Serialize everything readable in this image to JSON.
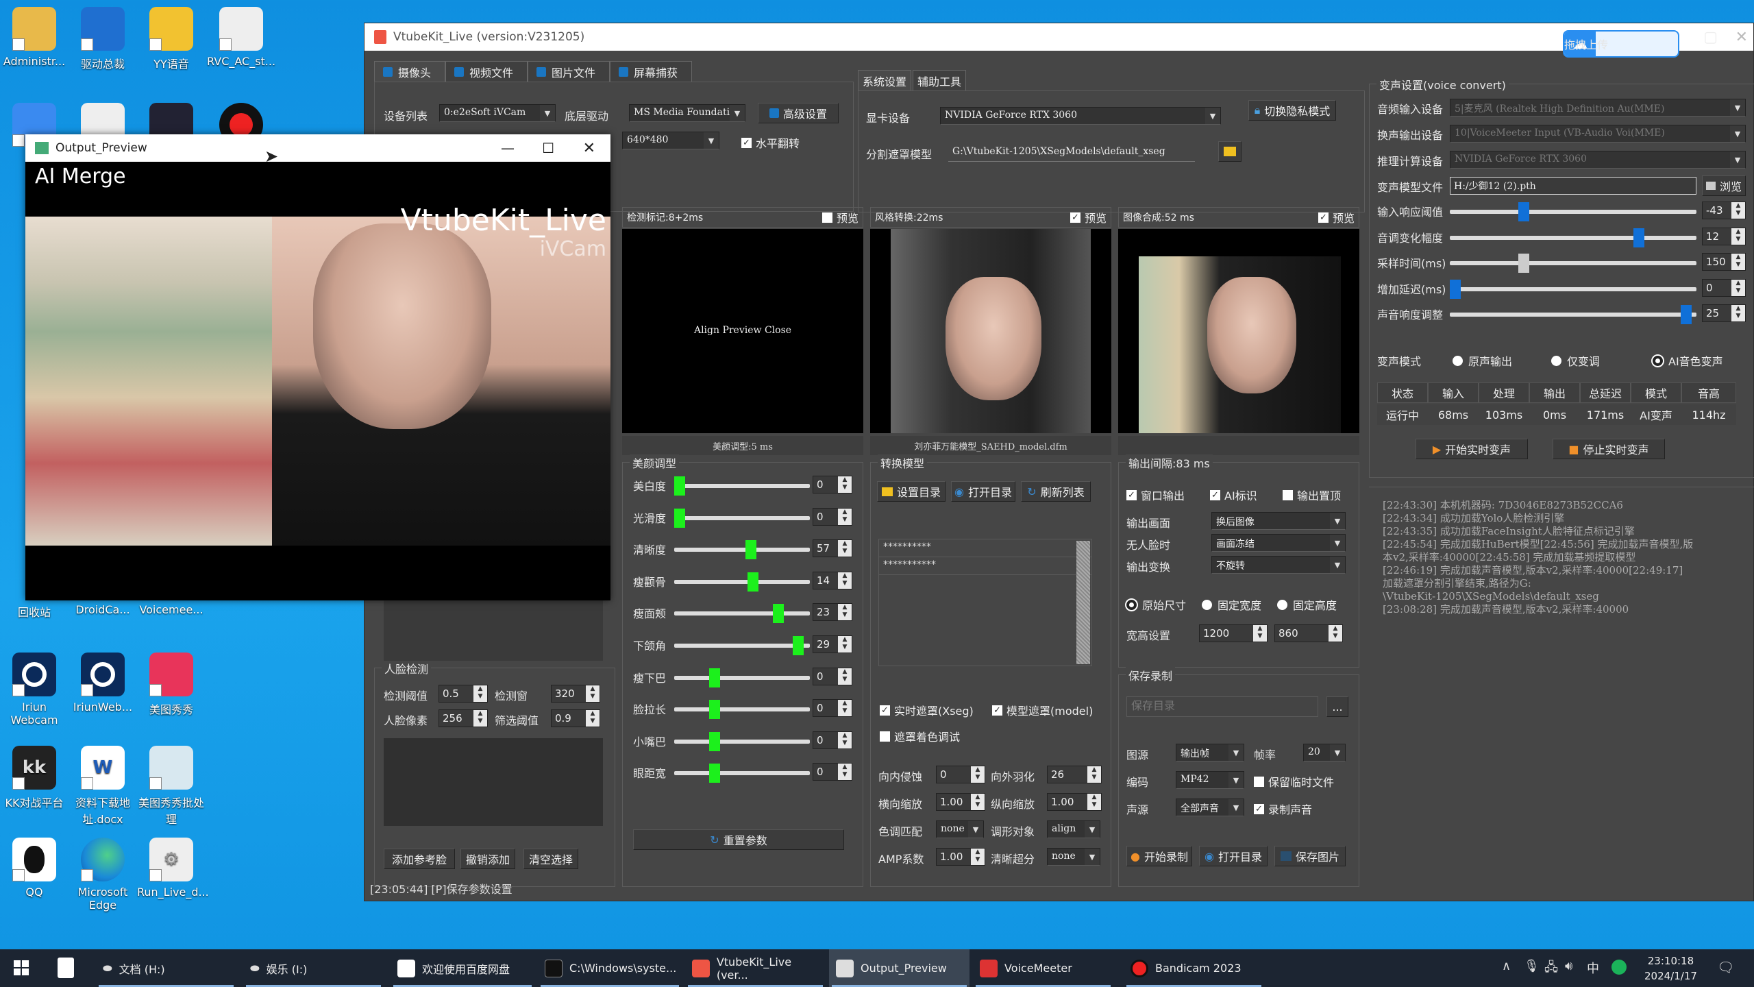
{
  "desktop": {
    "icons": [
      {
        "label": "Administr...",
        "color": "#e8b94a"
      },
      {
        "label": "驱动总裁",
        "color": "#1f6fd0"
      },
      {
        "label": "YY语音",
        "color": "#f2c230"
      },
      {
        "label": "RVC_AC_st...",
        "color": "#eeeeee"
      },
      {
        "label": "回收站",
        "color": "#9cc"
      },
      {
        "label": "DroidCa...",
        "color": "#4a4a4a"
      },
      {
        "label": "Voicemee...",
        "color": "#333"
      },
      {
        "label": "Iriun Webcam",
        "color": "#0b2a5a"
      },
      {
        "label": "IriunWeb...",
        "color": "#0b2a5a"
      },
      {
        "label": "美图秀秀",
        "color": "#e8345a"
      },
      {
        "label": "KK对战平台",
        "color": "#222"
      },
      {
        "label": "资料下载地址.docx",
        "color": "#fff"
      },
      {
        "label": "美图秀秀批处理",
        "color": "#d8e8f0"
      },
      {
        "label": "QQ",
        "color": "#fff"
      },
      {
        "label": "Microsoft Edge",
        "color": "#1a8ad8"
      },
      {
        "label": "Run_Live_d...",
        "color": "#eee"
      }
    ]
  },
  "main_window": {
    "title": "VtubeKit_Live (version:V231205)",
    "upload_button": "拖拽上传",
    "source_tabs": [
      "摄像头",
      "视频文件",
      "图片文件",
      "屏幕捕获"
    ],
    "camera": {
      "device_label": "设备列表",
      "device_value": "0:e2eSoft iVCam",
      "driver_label": "底层驱动",
      "driver_value": "MS Media Foundatio",
      "advanced_button": "高级设置",
      "resolution_value": "640*480",
      "hflip_label": "水平翻转",
      "hflip_checked": true
    },
    "system_tabs": [
      "系统设置",
      "辅助工具"
    ],
    "system": {
      "gpu_label": "显卡设备",
      "gpu_value": "NVIDIA GeForce RTX 3060",
      "privacy_button": "切换隐私模式",
      "mask_label": "分割遮罩模型",
      "mask_path": "G:\\VtubeKit-1205\\XSegModels\\default_xseg"
    },
    "previews": [
      {
        "title": "检测标记:8+2ms",
        "preview_label": "预览",
        "checked": false,
        "overlay": "Align Preview Close",
        "footer": "美颜调型:5 ms"
      },
      {
        "title": "风格转换:22ms",
        "preview_label": "预览",
        "checked": true,
        "footer": "刘亦菲万能模型_SAEHD_model.dfm"
      },
      {
        "title": "图像合成:52 ms",
        "preview_label": "预览",
        "checked": true,
        "footer": ""
      }
    ],
    "beauty": {
      "title": "美颜调型",
      "sliders": [
        {
          "label": "美白度",
          "value": "0",
          "pos": 0.0
        },
        {
          "label": "光滑度",
          "value": "0",
          "pos": 0.0
        },
        {
          "label": "清晰度",
          "value": "57",
          "pos": 0.57
        },
        {
          "label": "瘦颧骨",
          "value": "14",
          "pos": 0.59
        },
        {
          "label": "瘦面颊",
          "value": "23",
          "pos": 0.79
        },
        {
          "label": "下颌角",
          "value": "29",
          "pos": 0.95
        },
        {
          "label": "瘦下巴",
          "value": "0",
          "pos": 0.28
        },
        {
          "label": "脸拉长",
          "value": "0",
          "pos": 0.28
        },
        {
          "label": "小嘴巴",
          "value": "0",
          "pos": 0.28
        },
        {
          "label": "眼距宽",
          "value": "0",
          "pos": 0.28
        }
      ],
      "reset_button": "重置参数"
    },
    "face_detect": {
      "title": "人脸检测",
      "threshold_label": "检测阈值",
      "threshold_value": "0.5",
      "window_label": "检测窗",
      "window_value": "320",
      "pixels_label": "人脸像素",
      "pixels_value": "256",
      "filter_label": "筛选阈值",
      "filter_value": "0.9",
      "buttons": [
        "添加参考脸",
        "撤销添加",
        "清空选择"
      ]
    },
    "model": {
      "title": "转换模型",
      "buttons": [
        "设置目录",
        "打开目录",
        "刷新列表"
      ],
      "list": [
        "**********",
        "***********"
      ],
      "xseg_label": "实时遮罩(Xseg)",
      "xseg_checked": true,
      "model_mask_label": "模型遮罩(model)",
      "model_mask_checked": true,
      "mask_color_label": "遮罩着色调试",
      "mask_color_checked": false,
      "erode_label": "向内侵蚀",
      "erode_value": "0",
      "feather_label": "向外羽化",
      "feather_value": "26",
      "hscale_label": "横向缩放",
      "hscale_value": "1.00",
      "vscale_label": "纵向缩放",
      "vscale_value": "1.00",
      "color_label": "色调匹配",
      "color_value": "none",
      "shape_label": "调形对象",
      "shape_value": "align",
      "amp_label": "AMP系数",
      "amp_value": "1.00",
      "sr_label": "清晰超分",
      "sr_value": "none"
    },
    "output": {
      "title": "输出间隔:83 ms",
      "window_out_label": "窗口输出",
      "window_out_checked": true,
      "ai_mark_label": "AI标识",
      "ai_mark_checked": true,
      "top_label": "输出置顶",
      "top_checked": false,
      "frame_label": "输出画面",
      "frame_value": "换后图像",
      "noface_label": "无人脸时",
      "noface_value": "画面冻结",
      "transform_label": "输出变换",
      "transform_value": "不旋转",
      "size_modes": [
        "原始尺寸",
        "固定宽度",
        "固定高度"
      ],
      "size_selected": 0,
      "wh_label": "宽高设置",
      "width_value": "1200",
      "height_value": "860"
    },
    "record": {
      "title": "保存录制",
      "dir_placeholder": "保存目录",
      "browse": "...",
      "source_label": "图源",
      "source_value": "输出帧",
      "fps_label": "帧率",
      "fps_value": "20",
      "codec_label": "编码",
      "codec_value": "MP42",
      "keep_temp_label": "保留临时文件",
      "keep_temp_checked": false,
      "audio_label": "声源",
      "audio_value": "全部声音",
      "rec_audio_label": "录制声音",
      "rec_audio_checked": true,
      "buttons": [
        "开始录制",
        "打开目录",
        "保存图片"
      ]
    },
    "voice": {
      "title": "变声设置(voice convert)",
      "input_label": "音频输入设备",
      "input_value": "5|麦克风 (Realtek High Definition Au(MME)",
      "output_label": "换声输出设备",
      "output_value": "10|VoiceMeeter Input (VB-Audio Voi(MME)",
      "compute_label": "推理计算设备",
      "compute_value": "NVIDIA GeForce RTX 3060",
      "model_label": "变声模型文件",
      "model_value": "H:/少御12 (2).pth",
      "browse_button": "浏览",
      "sliders": [
        {
          "label": "输入响应阈值",
          "value": "-43",
          "pos": 0.29,
          "style": "blue"
        },
        {
          "label": "音调变化幅度",
          "value": "12",
          "pos": 0.78,
          "style": "blue"
        },
        {
          "label": "采样时间(ms)",
          "value": "150",
          "pos": 0.29,
          "style": "grey"
        },
        {
          "label": "增加延迟(ms)",
          "value": "0",
          "pos": 0.0,
          "style": "blue"
        },
        {
          "label": "声音响度调整",
          "value": "25",
          "pos": 0.98,
          "style": "blue"
        }
      ],
      "mode_label": "变声模式",
      "modes": [
        "原声输出",
        "仅变调",
        "AI音色变声"
      ],
      "mode_selected": 2,
      "status_headers": [
        "状态",
        "输入",
        "处理",
        "输出",
        "总延迟",
        "模式",
        "音高"
      ],
      "status_values": [
        "运行中",
        "68ms",
        "103ms",
        "0ms",
        "171ms",
        "AI变声",
        "114hz"
      ],
      "start_button": "开始实时变声",
      "stop_button": "停止实时变声"
    },
    "log_lines": [
      "[22:43:30] 本机机器码: 7D3046E8273B52CCA6",
      "[22:43:34] 成功加载Yolo人脸检测引擎",
      "[22:43:35] 成功加载FaceInsight人脸特征点标记引擎",
      "[22:45:54] 完成加载HuBert模型[22:45:56] 完成加载声音模型,版",
      "本v2,采样率:40000[22:45:58] 完成加载基频提取模型",
      "[22:46:19] 完成加载声音模型,版本v2,采样率:40000[22:49:17]",
      "加载遮罩分割引擎结束,路径为G:",
      "\\VtubeKit-1205\\XSegModels\\default_xseg",
      "[23:08:28] 完成加载声音模型,版本v2,采样率:40000"
    ],
    "status_bar": "[23:05:44] [P]保存参数设置"
  },
  "preview_window": {
    "title": "Output_Preview",
    "overlay_top": "AI Merge",
    "overlay_brand": "VtubeKit_Live",
    "overlay_sub": "iVCam"
  },
  "taskbar": {
    "items": [
      {
        "label": "文档 (H:)",
        "active": false
      },
      {
        "label": "娱乐 (I:)",
        "active": false
      },
      {
        "label": "欢迎使用百度网盘",
        "active": false
      },
      {
        "label": "C:\\Windows\\syste...",
        "active": false
      },
      {
        "label": "VtubeKit_Live (ver...",
        "active": false
      },
      {
        "label": "Output_Preview",
        "active": true
      },
      {
        "label": "VoiceMeeter",
        "active": false
      },
      {
        "label": "Bandicam 2023",
        "active": false
      }
    ],
    "tray_ime": "中",
    "time": "23:10:18",
    "date": "2024/1/17"
  }
}
